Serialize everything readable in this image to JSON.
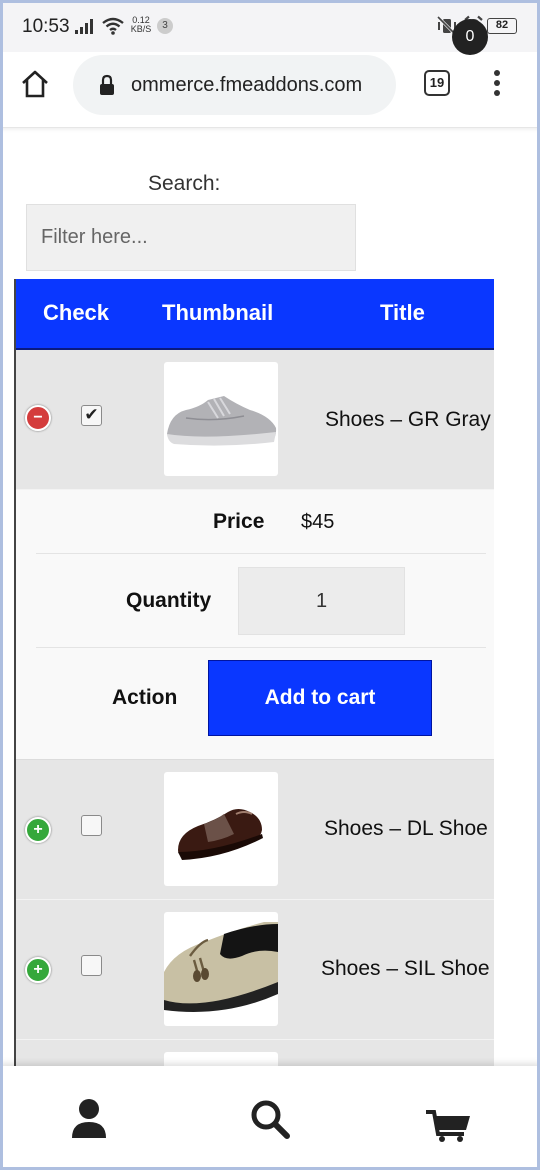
{
  "status_bar": {
    "time": "10:53",
    "net_speed_value": "0.12",
    "net_speed_unit": "KB/S",
    "notification_count": "3",
    "battery": "82"
  },
  "browser": {
    "url": "ommerce.fmeaddons.com",
    "tab_count": "19"
  },
  "search": {
    "label": "Search:",
    "placeholder": "Filter here..."
  },
  "table": {
    "headers": {
      "check": "Check",
      "thumbnail": "Thumbnail",
      "title": "Title"
    },
    "rows": [
      {
        "title": "Shoes – GR Gray",
        "checked": true,
        "expanded": true,
        "thumb_icon": "gray-sneaker-icon"
      },
      {
        "title": "Shoes – DL Shoe",
        "checked": false,
        "expanded": false,
        "thumb_icon": "brown-dress-shoe-icon"
      },
      {
        "title": "Shoes – SIL Shoe",
        "checked": false,
        "expanded": false,
        "thumb_icon": "silver-loafer-icon"
      }
    ],
    "details": {
      "price_label": "Price",
      "price_value": "$45",
      "quantity_label": "Quantity",
      "quantity_value": "1",
      "action_label": "Action",
      "add_to_cart_label": "Add to cart"
    }
  },
  "bottom_nav": {
    "cart_count": "0"
  },
  "colors": {
    "accent": "#0a37ff",
    "row_bg": "#e6e6e6",
    "collapse": "#d43c3c",
    "expand": "#35a83b"
  }
}
